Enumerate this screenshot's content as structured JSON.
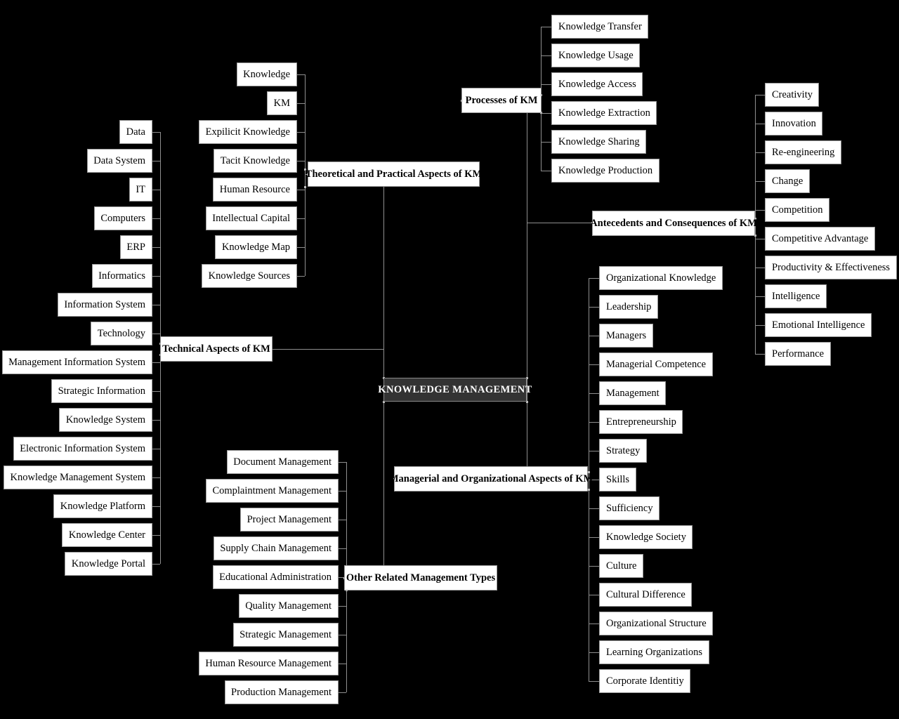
{
  "diagram": {
    "title": "KNOWLEDGE MANAGEMENT",
    "type": "mind-map",
    "root": {
      "label": "KNOWLEDGE MANAGEMENT",
      "background": "#333333",
      "text_color": "#ffffff"
    },
    "canvas_background": "#000000",
    "node_background": "#ffffff",
    "node_border": "#9a9a9a",
    "connector_color": "#8f8f8f"
  },
  "branches": {
    "technical": {
      "label": "Technical Aspects of KM",
      "side": "left",
      "leaves": [
        "Data",
        "Data System",
        "IT",
        "Computers",
        "ERP",
        "Informatics",
        "Information System",
        "Technology",
        "Management Information System",
        "Strategic Information",
        "Knowledge System",
        "Electronic Information System",
        "Knowledge Management System",
        "Knowledge Platform",
        "Knowledge Center",
        "Knowledge Portal"
      ]
    },
    "theoretical": {
      "label": "Theoretical and Practical Aspects of KM",
      "side": "left",
      "leaves": [
        "Knowledge",
        "KM",
        "Expilicit Knowledge",
        "Tacit Knowledge",
        "Human Resource",
        "Intellectual Capital",
        "Knowledge Map",
        "Knowledge Sources"
      ]
    },
    "other_related": {
      "label": "Other Related Management Types",
      "side": "left",
      "leaves": [
        "Document Management",
        "Complaintment Management",
        "Project Management",
        "Supply Chain Management",
        "Educational Administration",
        "Quality Management",
        "Strategic Management",
        "Human Resource Management",
        "Production Management"
      ]
    },
    "processes": {
      "label": "Processes of KM",
      "side": "right",
      "leaves": [
        "Knowledge Transfer",
        "Knowledge Usage",
        "Knowledge Access",
        "Knowledge Extraction",
        "Knowledge Sharing",
        "Knowledge Production"
      ]
    },
    "antecedents": {
      "label": "Antecedents and Consequences of KM",
      "side": "right",
      "leaves": [
        "Creativity",
        "Innovation",
        "Re-engineering",
        "Change",
        "Competition",
        "Competitive Advantage",
        "Productivity & Effectiveness",
        "Intelligence",
        "Emotional Intelligence",
        "Performance"
      ]
    },
    "managerial": {
      "label": "Managerial and Organizational Aspects of KM",
      "side": "right",
      "leaves": [
        "Organizational Knowledge",
        "Leadership",
        "Managers",
        "Managerial Competence",
        "Management",
        "Entrepreneurship",
        "Strategy",
        "Skills",
        "Sufficiency",
        "Knowledge Society",
        "Culture",
        "Cultural Difference",
        "Organizational Structure",
        "Learning Organizations",
        "Corporate Identitiy"
      ]
    }
  }
}
